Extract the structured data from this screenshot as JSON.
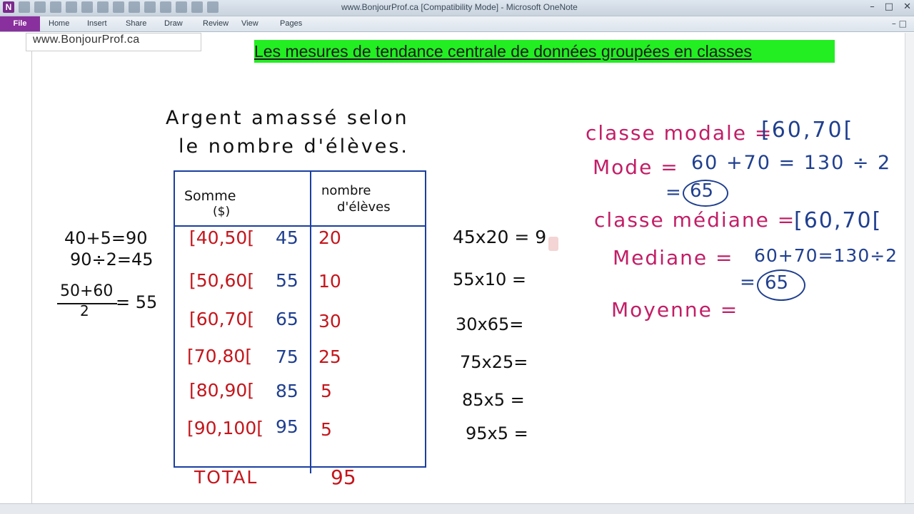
{
  "window": {
    "title": "www.BonjourProf.ca [Compatibility Mode] - Microsoft OneNote",
    "app_logo": "N",
    "controls": [
      "–",
      "□",
      "✕"
    ]
  },
  "ribbon": {
    "file": "File",
    "tabs": [
      "Home",
      "Insert",
      "Share",
      "Draw",
      "Review",
      "View",
      "Pages"
    ],
    "controls": "–  □"
  },
  "page": {
    "url": "www.BonjourProf.ca",
    "heading": "Les mesures de tendance centrale de données groupées en classes"
  },
  "notes": {
    "table_title_1": "Argent amassé selon",
    "table_title_2": "le nombre d'élèves.",
    "col_somme": "Somme",
    "col_somme_unit": "($)",
    "col_nombre_1": "nombre",
    "col_nombre_2": "d'élèves",
    "rows": [
      {
        "classe": "[40,50[",
        "centre": "45",
        "n": "20",
        "produit": "45x20 = 9"
      },
      {
        "classe": "[50,60[",
        "centre": "55",
        "n": "10",
        "produit": "55x10 ="
      },
      {
        "classe": "[60,70[",
        "centre": "65",
        "n": "30",
        "produit": "30x65="
      },
      {
        "classe": "[70,80[",
        "centre": "75",
        "n": "25",
        "produit": "75x25="
      },
      {
        "classe": "[80,90[",
        "centre": "85",
        "n": "5",
        "produit": "85x5 ="
      },
      {
        "classe": "[90,100[",
        "centre": "95",
        "n": "5",
        "produit": "95x5 ="
      }
    ],
    "total_label": "TOTAL",
    "total_value": "95",
    "left_calc_1": "40+5=90",
    "left_calc_2": "90÷2=45",
    "left_frac_num": "50+60",
    "left_frac_den": "2",
    "left_frac_res": "= 55",
    "classe_modale": "classe modale =",
    "classe_modale_val": "[60,70[",
    "mode_label": "Mode =",
    "mode_calc": "60 +70 = 130 ÷ 2",
    "mode_eq": "=",
    "mode_val": "65",
    "classe_mediane": "classe médiane =",
    "classe_mediane_val": "[60,70[",
    "mediane_label": "Mediane =",
    "mediane_calc": "60+70=130÷2",
    "mediane_eq": "=",
    "mediane_val": "65",
    "moyenne_label": "Moyenne ="
  },
  "colors": {
    "heading_bg": "#22ee22",
    "ink_black": "#111111",
    "ink_red": "#c4161c",
    "ink_blue": "#1f3f8f",
    "ink_magenta": "#c21e66",
    "table_border": "#1b3fa0",
    "file_tab": "#8a2f9e"
  }
}
